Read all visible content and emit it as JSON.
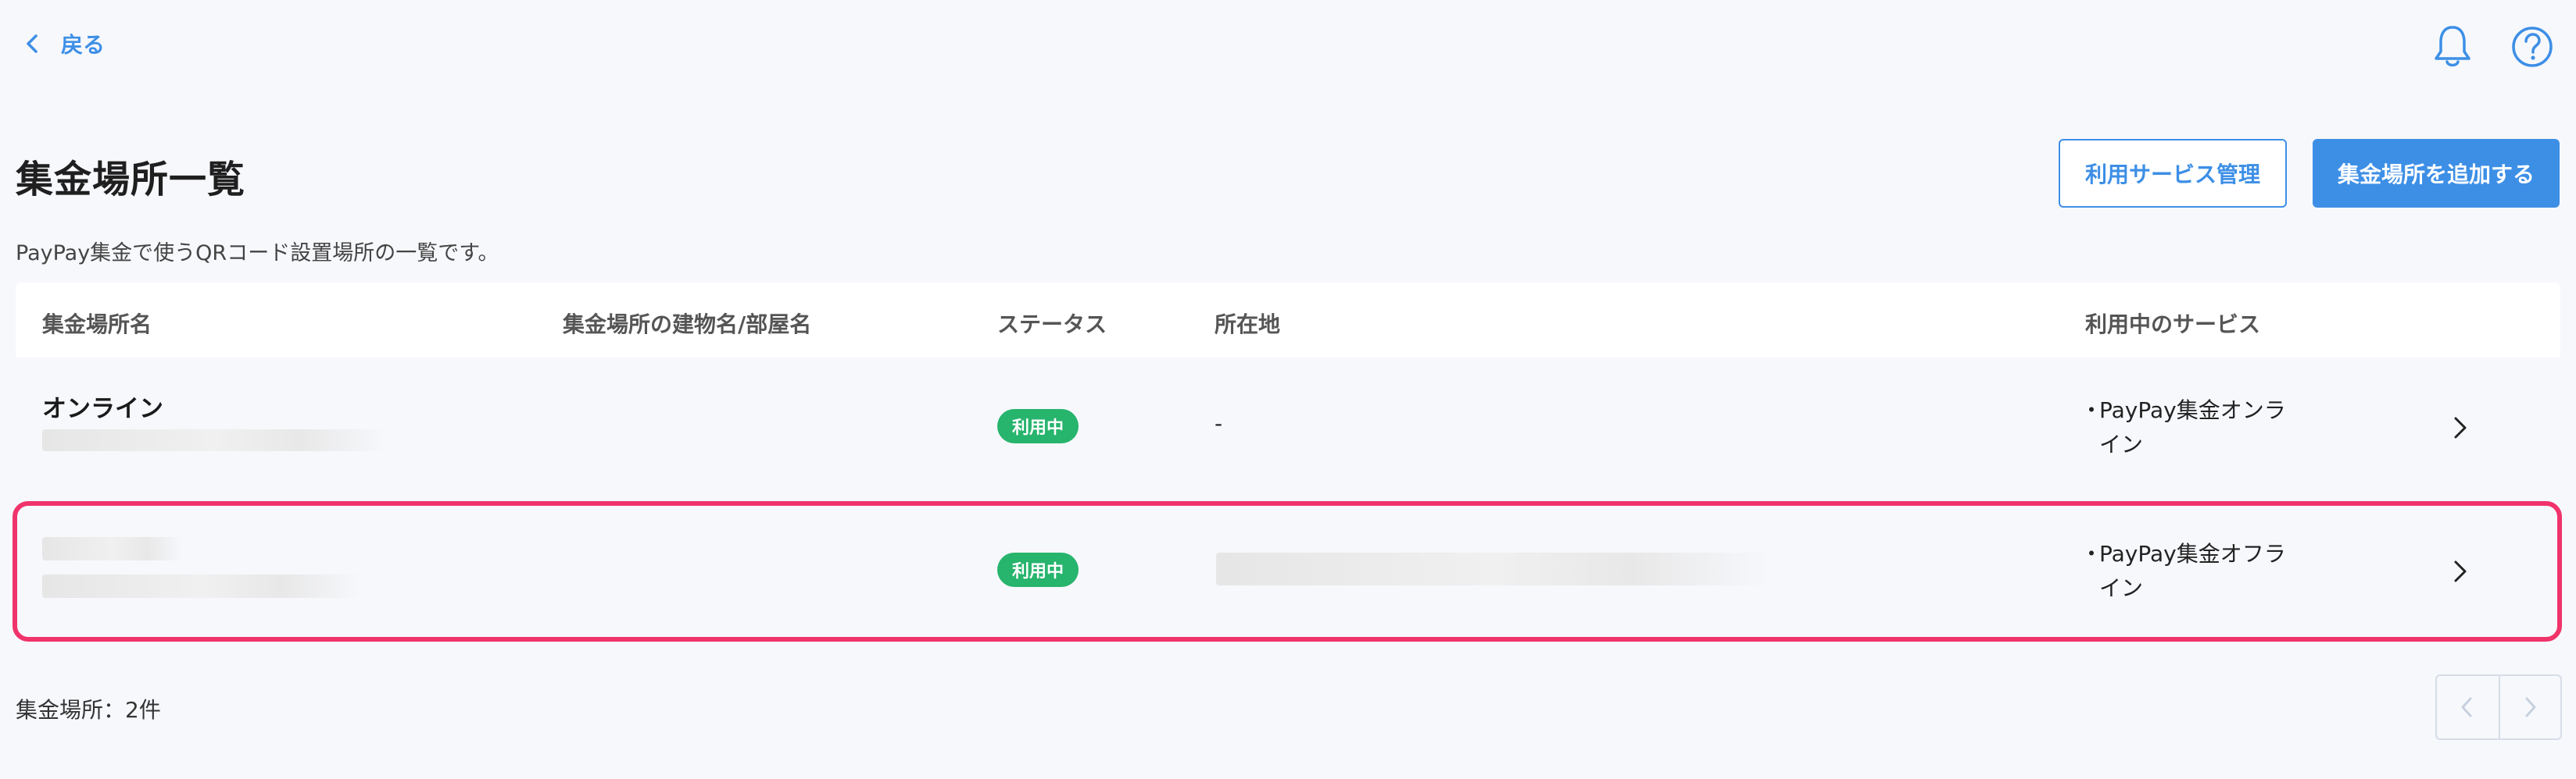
{
  "topbar": {
    "back_label": "戻る",
    "icons": [
      "chevron-left-icon",
      "bell-icon",
      "help-icon"
    ]
  },
  "header": {
    "title": "集金場所一覧",
    "description": "PayPay集金で使うQRコード設置場所の一覧です。",
    "manage_button": "利用サービス管理",
    "add_button": "集金場所を追加する"
  },
  "table": {
    "columns": [
      "集金場所名",
      "集金場所の建物名/部屋名",
      "ステータス",
      "所在地",
      "利用中のサービス"
    ],
    "rows": [
      {
        "name": "オンライン",
        "status": "利用中",
        "address": "-",
        "service_bullet": "・",
        "service": "PayPay集金オンライン"
      },
      {
        "name": "",
        "status": "利用中",
        "address": "",
        "service_bullet": "・",
        "service": "PayPay集金オフライン"
      }
    ]
  },
  "footer": {
    "count": "集金場所：2件"
  },
  "colors": {
    "accent": "#3d8fe6",
    "status_active": "#27b46d",
    "highlight": "#f0336b",
    "background": "#f7f8fc"
  }
}
